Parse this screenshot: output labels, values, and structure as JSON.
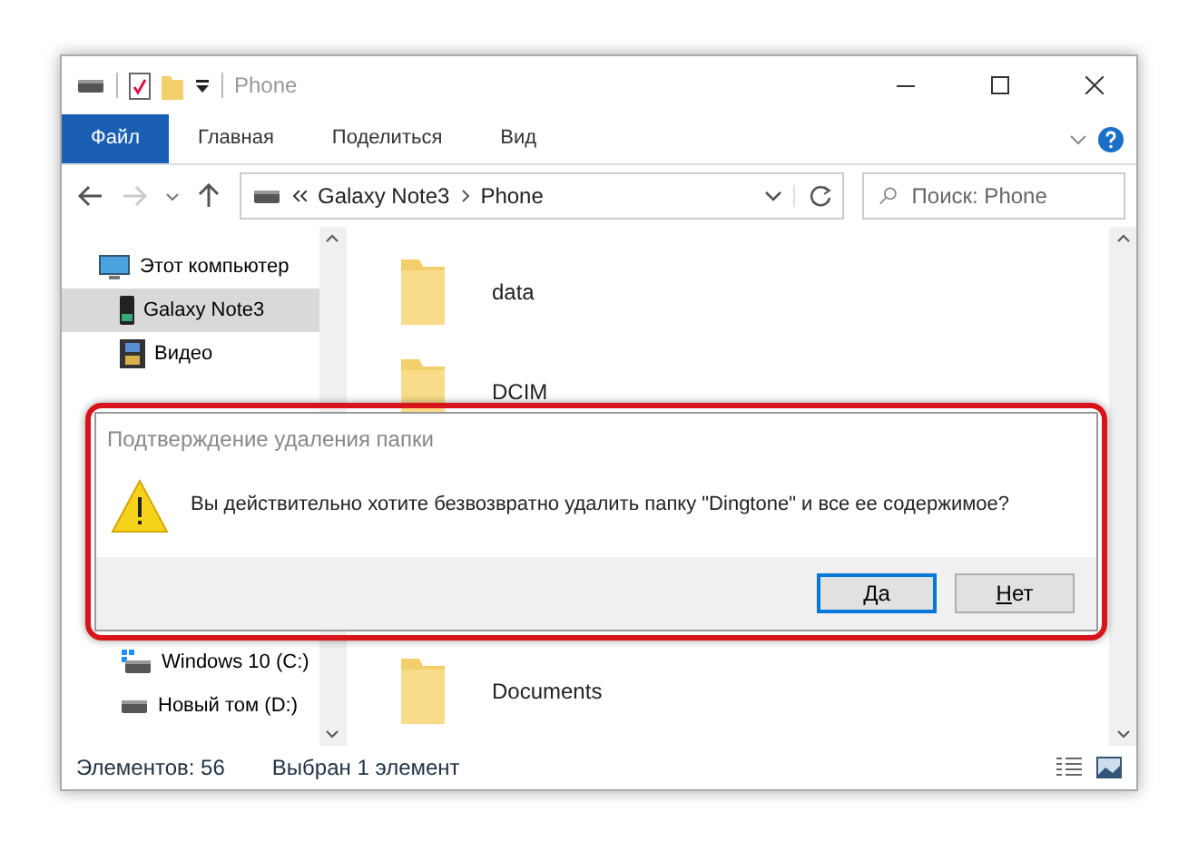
{
  "window": {
    "title": "Phone"
  },
  "ribbon_tabs": [
    {
      "label": "Файл",
      "kind": "file"
    },
    {
      "label": "Главная",
      "kind": "tab"
    },
    {
      "label": "Поделиться",
      "kind": "tab"
    },
    {
      "label": "Вид",
      "kind": "tab"
    }
  ],
  "address": {
    "path": [
      "Galaxy Note3",
      "Phone"
    ]
  },
  "search": {
    "placeholder": "Поиск: Phone"
  },
  "sidebar": {
    "items": [
      {
        "label": "Этот компьютер",
        "kind": "computer",
        "selected": false,
        "children": [
          {
            "label": "Galaxy Note3",
            "kind": "phone",
            "selected": true
          },
          {
            "label": "Видео",
            "kind": "video",
            "selected": false
          }
        ]
      }
    ],
    "items_below": [
      {
        "label": "Windows 10 (C:)",
        "kind": "system-drive",
        "selected": false
      },
      {
        "label": "Новый том (D:)",
        "kind": "drive",
        "selected": false
      }
    ]
  },
  "files": [
    {
      "name": "data"
    },
    {
      "name": "DCIM"
    },
    {
      "name": "Documents"
    }
  ],
  "status_bar": {
    "count": "Элементов: 56",
    "selection": "Выбран 1 элемент"
  },
  "dialog": {
    "title": "Подтверждение удаления папки",
    "message": "Вы действительно хотите безвозвратно удалить папку \"Dingtone\" и все ее содержимое?",
    "buttons": [
      {
        "label": "Да",
        "default": true
      },
      {
        "label": "Нет",
        "default": false
      }
    ]
  }
}
